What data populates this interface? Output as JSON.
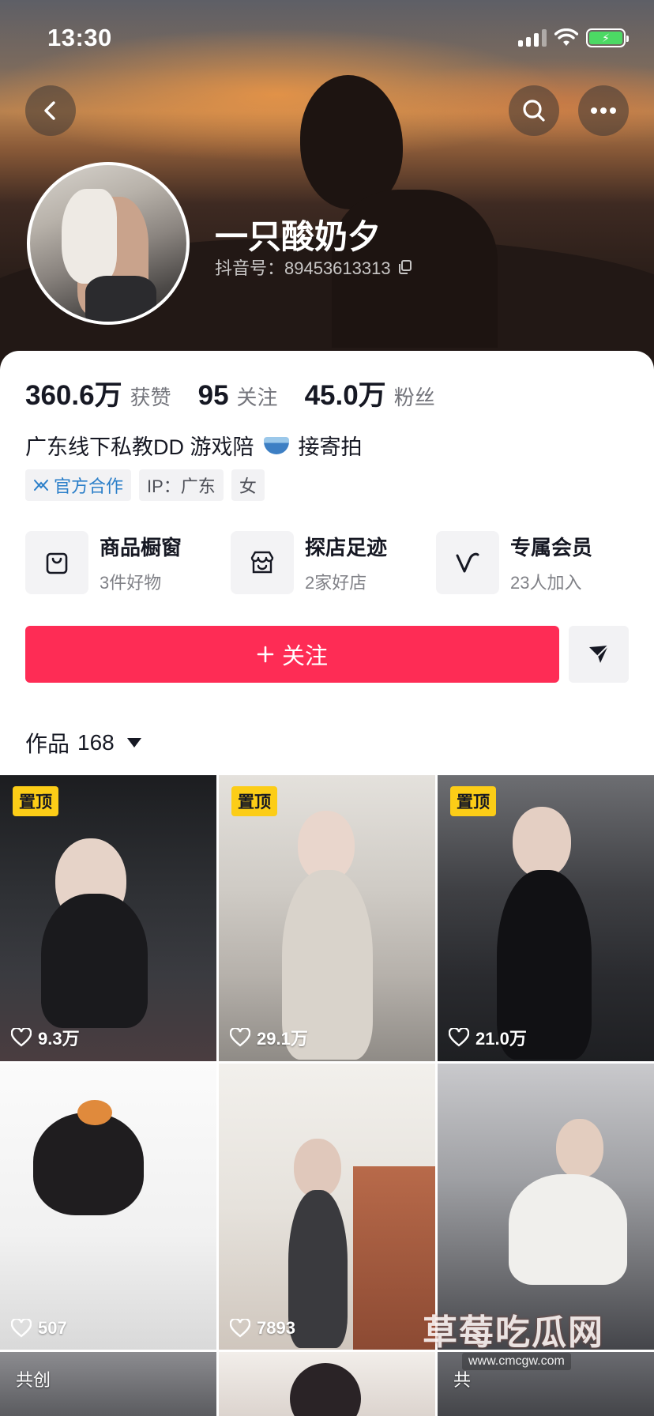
{
  "status_bar": {
    "time": "13:30"
  },
  "profile": {
    "nickname": "一只酸奶夕",
    "douyin_id": "抖音号：89453613313"
  },
  "stats": [
    {
      "value": "360.6万",
      "label": "获赞"
    },
    {
      "value": "95",
      "label": "关注"
    },
    {
      "value": "45.0万",
      "label": "粉丝"
    }
  ],
  "bio": {
    "text_before": "广东线下私教DD  游戏陪",
    "text_after": "接寄拍"
  },
  "tags": [
    {
      "label": "官方合作"
    },
    {
      "label": "IP：广东"
    },
    {
      "label": "女"
    }
  ],
  "features": [
    {
      "title": "商品橱窗",
      "subtitle": "3件好物",
      "icon": "shopping-bag-icon"
    },
    {
      "title": "探店足迹",
      "subtitle": "2家好店",
      "icon": "store-icon"
    },
    {
      "title": "专属会员",
      "subtitle": "23人加入",
      "icon": "vip-v-icon"
    }
  ],
  "actions": {
    "follow_label": "关注"
  },
  "works": {
    "label": "作品",
    "count": "168",
    "tiles": [
      {
        "pinned": "置顶",
        "likes": "9.3万"
      },
      {
        "pinned": "置顶",
        "likes": "29.1万"
      },
      {
        "pinned": "置顶",
        "likes": "21.0万"
      },
      {
        "likes": "507"
      },
      {
        "likes": "7893"
      },
      {
        "likes": ""
      },
      {
        "corner_label": "共创"
      },
      {
        "corner_label": ""
      },
      {
        "corner_label": "共"
      }
    ]
  },
  "watermark": {
    "text": "草莓吃瓜网",
    "url": "www.cmcgw.com"
  },
  "colors": {
    "accent": "#fe2c55",
    "pin": "#fccd17",
    "official": "#2b7fc9"
  }
}
